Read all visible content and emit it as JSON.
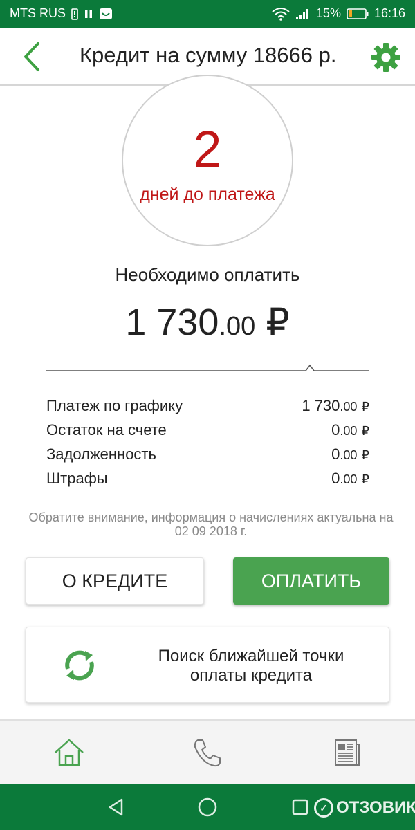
{
  "status_bar": {
    "carrier": "MTS RUS",
    "battery_percent": "15%",
    "time": "16:16",
    "icons": [
      "sim-alert-icon",
      "pause-icon",
      "smile-notification-icon",
      "wifi-icon",
      "signal-icon",
      "battery-low-icon"
    ]
  },
  "header": {
    "title": "Кредит на сумму 18666 р.",
    "back_icon": "chevron-left-icon",
    "settings_icon": "gear-icon",
    "accent_color": "#3ea142"
  },
  "countdown": {
    "days": "2",
    "label": "дней до платежа",
    "color": "#c01717"
  },
  "payment": {
    "need_label": "Необходимо оплатить",
    "amount_main": "1 730",
    "amount_cents": ".00",
    "currency": "₽"
  },
  "details": [
    {
      "label": "Платеж по графику",
      "main": "1 730",
      "cents": ".00",
      "currency": "₽"
    },
    {
      "label": "Остаток на счете",
      "main": "0",
      "cents": ".00",
      "currency": "₽"
    },
    {
      "label": "Задолженность",
      "main": "0",
      "cents": ".00",
      "currency": "₽"
    },
    {
      "label": "Штрафы",
      "main": "0",
      "cents": ".00",
      "currency": "₽"
    }
  ],
  "notice": "Обратите внимание, информация о начислениях актуальна на 02 09 2018 г.",
  "buttons": {
    "about": "О КРЕДИТЕ",
    "pay": "ОПЛАТИТЬ",
    "pay_color": "#4aa350"
  },
  "search_card": {
    "text": "Поиск ближайшей точки оплаты кредита",
    "icon": "refresh-icon"
  },
  "tab_bar": {
    "items": [
      {
        "icon": "home-icon",
        "active": true
      },
      {
        "icon": "phone-icon",
        "active": false
      },
      {
        "icon": "news-icon",
        "active": false
      }
    ]
  },
  "nav_bar": {
    "icons": [
      "back-triangle-icon",
      "home-circle-icon",
      "recent-square-icon"
    ],
    "watermark": "ОТЗОВИК"
  }
}
